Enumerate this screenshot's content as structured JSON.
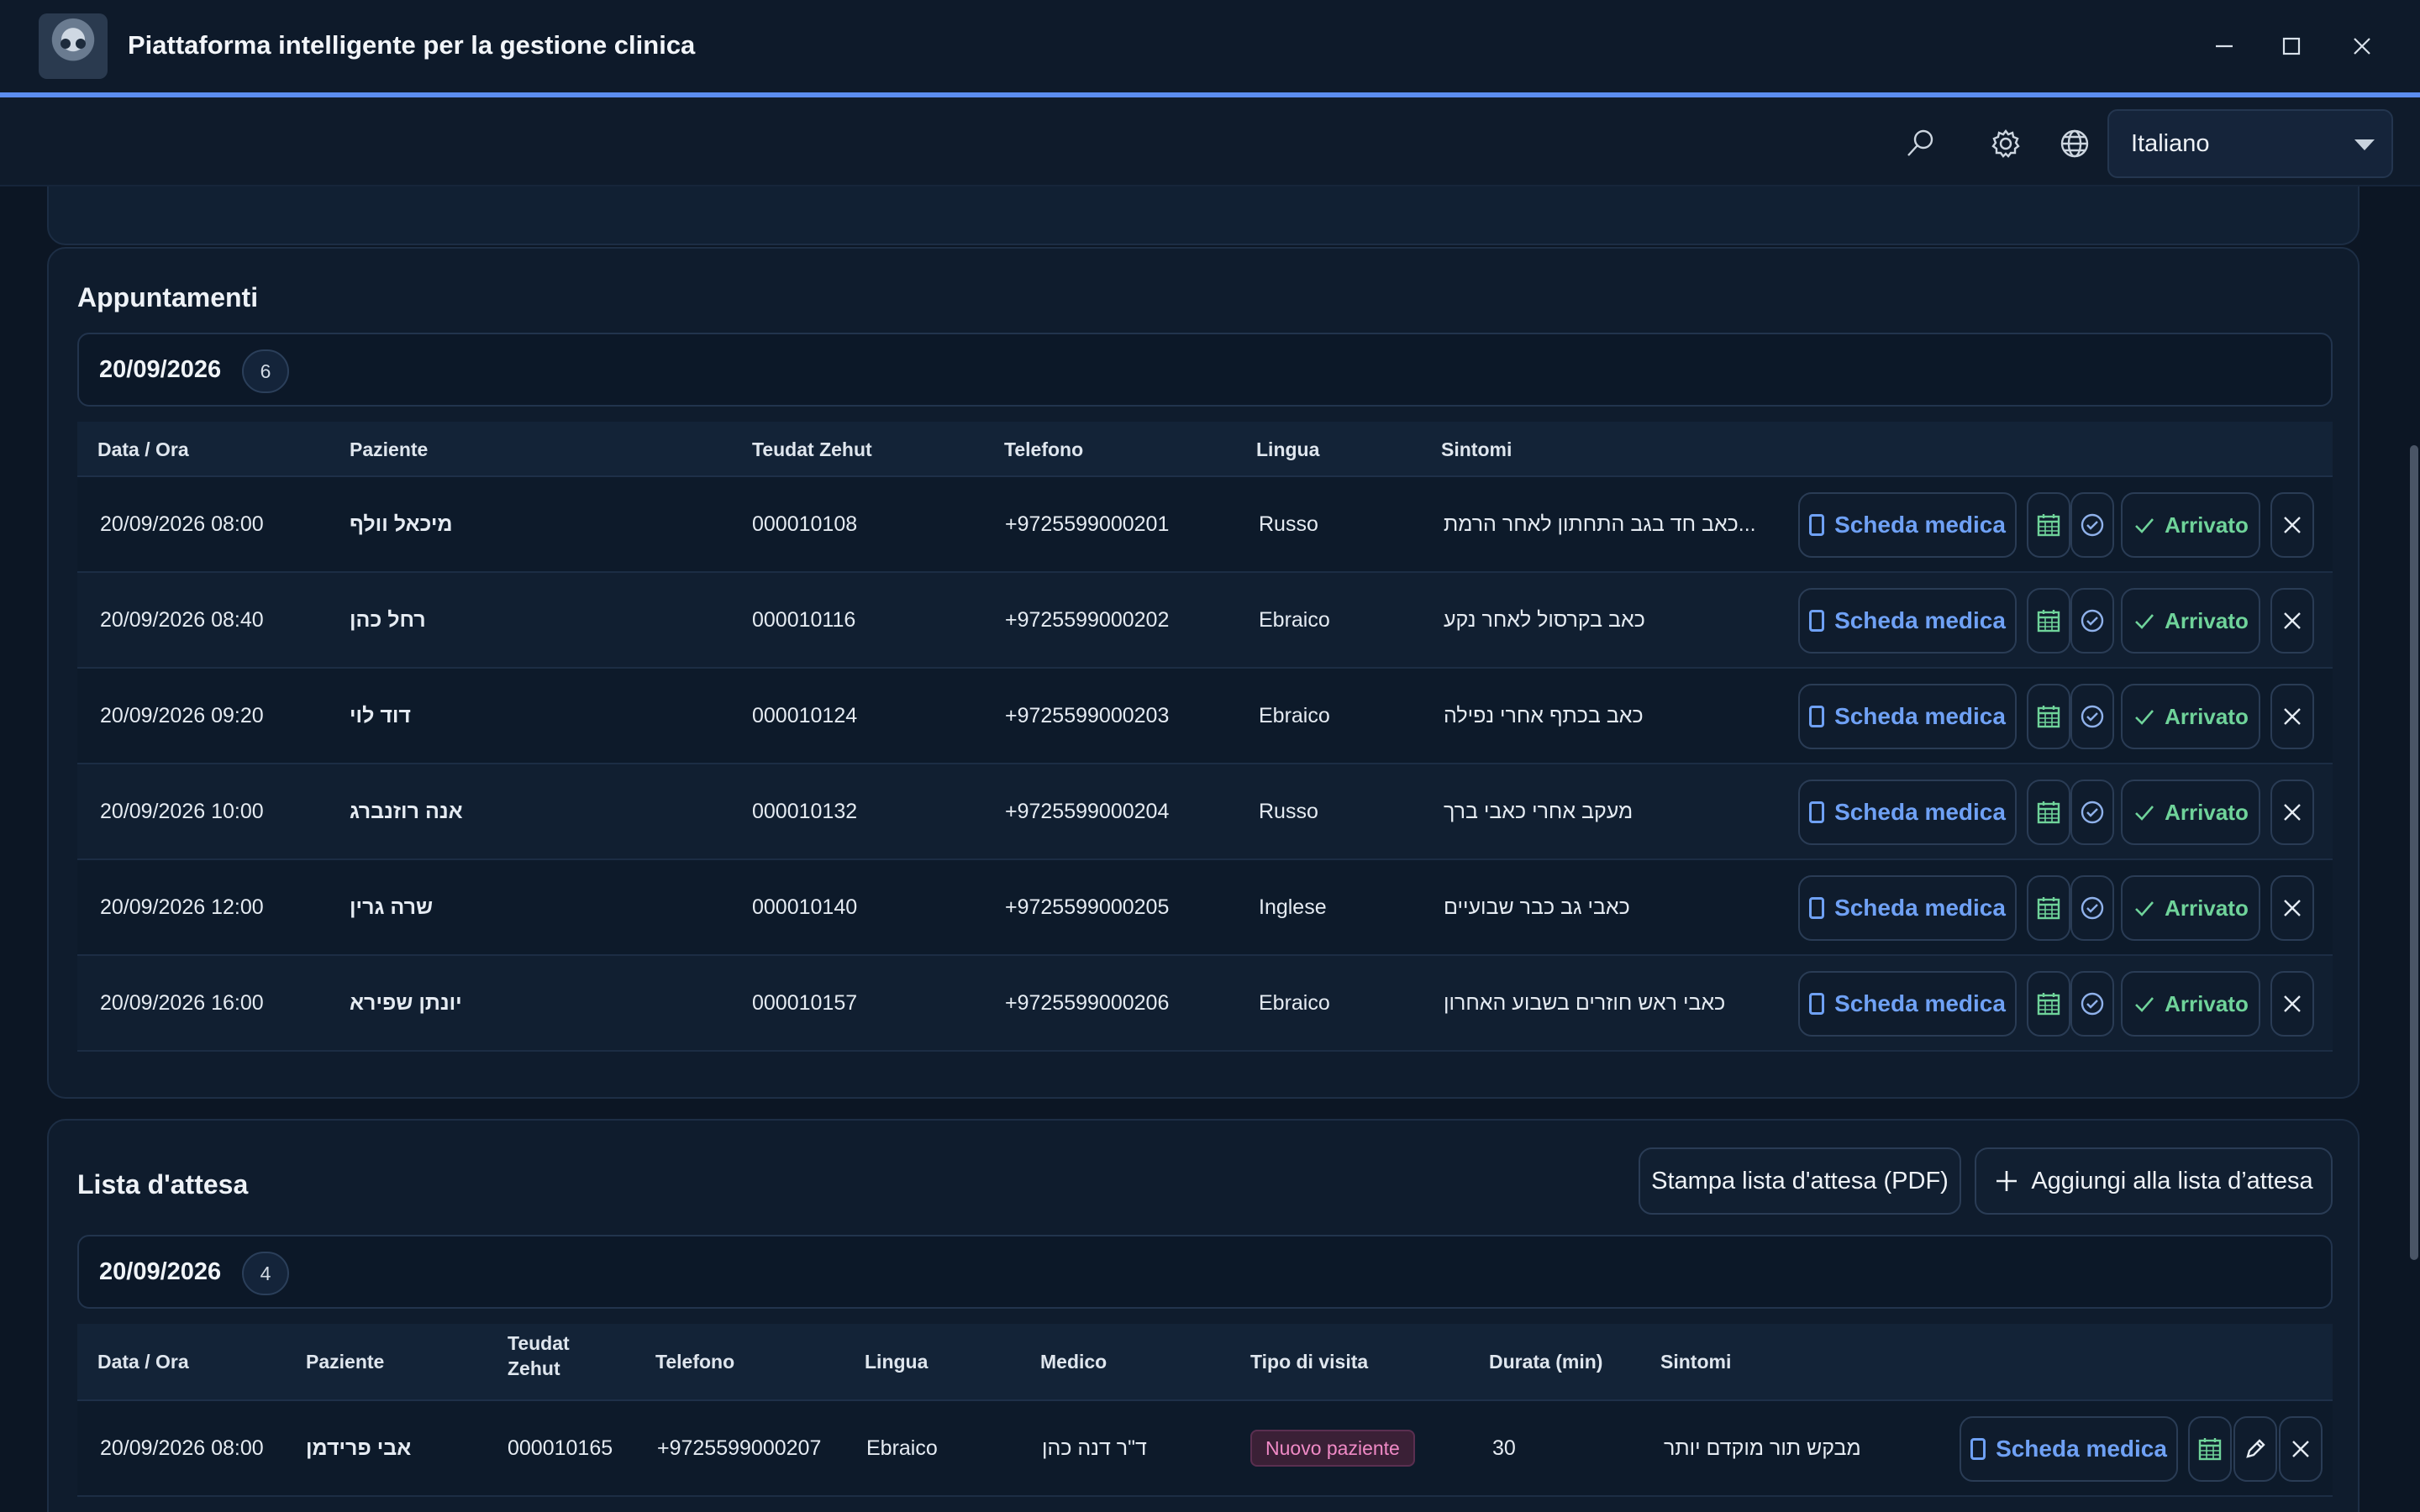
{
  "window": {
    "title": "Piattaforma intelligente per la gestione clinica"
  },
  "toolbar": {
    "language": "Italiano"
  },
  "appointments": {
    "title": "Appuntamenti",
    "date": "20/09/2026",
    "count": "6",
    "columns": [
      "Data / Ora",
      "Paziente",
      "Teudat Zehut",
      "Telefono",
      "Lingua",
      "Sintomi"
    ],
    "rows": [
      {
        "datetime": "20/09/2026 08:00",
        "patient": "מיכאל וולף",
        "id": "000010108",
        "phone": "+9725599000201",
        "language": "Russo",
        "symptoms": "כאב חד בגב התחתון לאחר הרמת..."
      },
      {
        "datetime": "20/09/2026 08:40",
        "patient": "רחל כהן",
        "id": "000010116",
        "phone": "+9725599000202",
        "language": "Ebraico",
        "symptoms": "כאב בקרסול לאחר נקע"
      },
      {
        "datetime": "20/09/2026 09:20",
        "patient": "דוד לוי",
        "id": "000010124",
        "phone": "+9725599000203",
        "language": "Ebraico",
        "symptoms": "כאב בכתף אחרי נפילה"
      },
      {
        "datetime": "20/09/2026 10:00",
        "patient": "אנה רוזנברג",
        "id": "000010132",
        "phone": "+9725599000204",
        "language": "Russo",
        "symptoms": "מעקב אחרי כאבי ברך"
      },
      {
        "datetime": "20/09/2026 12:00",
        "patient": "שרה גרין",
        "id": "000010140",
        "phone": "+9725599000205",
        "language": "Inglese",
        "symptoms": "כאבי גב כבר שבועיים"
      },
      {
        "datetime": "20/09/2026 16:00",
        "patient": "יונתן שפירא",
        "id": "000010157",
        "phone": "+9725599000206",
        "language": "Ebraico",
        "symptoms": "כאבי ראש חוזרים בשבוע האחרון"
      }
    ],
    "chart_label": "Scheda medica",
    "arrived_label": "Arrivato"
  },
  "waitlist": {
    "title": "Lista d'attesa",
    "print_label": "Stampa lista d'attesa (PDF)",
    "add_label": "Aggiungi alla lista d’attesa",
    "date": "20/09/2026",
    "count": "4",
    "columns": [
      "Data / Ora",
      "Paziente",
      "Teudat Zehut",
      "Telefono",
      "Lingua",
      "Medico",
      "Tipo di visita",
      "Durata (min)",
      "Sintomi"
    ],
    "rows": [
      {
        "datetime": "20/09/2026 08:00",
        "patient": "אבי פרידמן",
        "id": "000010165",
        "phone": "+9725599000207",
        "language": "Ebraico",
        "doctor": "ד\"ר דנה כהן",
        "visit_type": "Nuovo paziente",
        "duration": "30",
        "symptoms": "מבקש תור מוקדם יותר"
      }
    ],
    "chart_label": "Scheda medica"
  },
  "colors": {
    "accent": "#5b8def",
    "link": "#6fa1f5",
    "success": "#6fd39a",
    "badge": "#f08ac6"
  }
}
